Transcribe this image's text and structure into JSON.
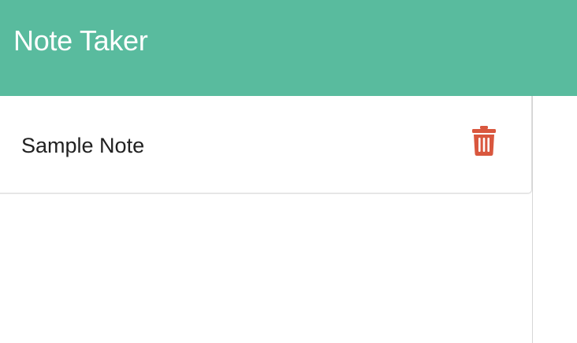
{
  "navbar": {
    "title": "Note Taker",
    "background_color": "#59bb9e"
  },
  "notes": [
    {
      "title": "Sample Note",
      "delete_icon": "trash-icon",
      "delete_color": "#d9573e"
    }
  ]
}
